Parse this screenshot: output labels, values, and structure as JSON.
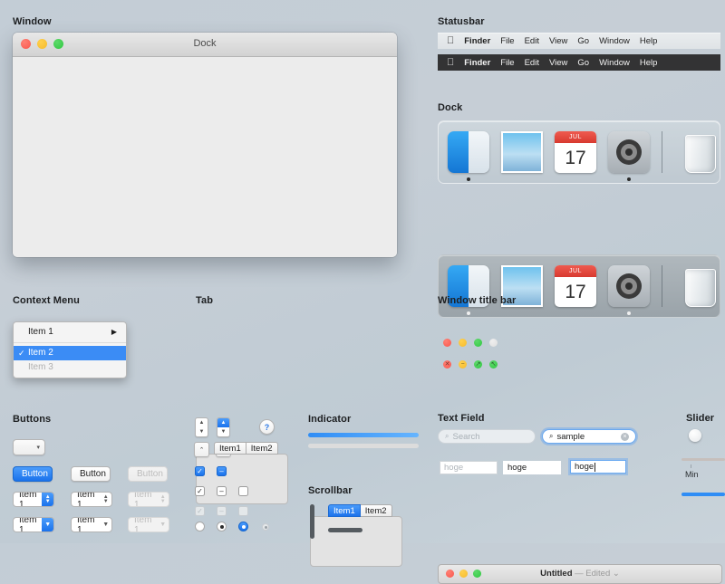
{
  "sections": {
    "window": "Window",
    "statusbar": "Statusbar",
    "dock": "Dock",
    "context_menu": "Context Menu",
    "tab": "Tab",
    "window_title_bar": "Window title bar",
    "buttons": "Buttons",
    "indicator": "Indicator",
    "scrollbar": "Scrollbar",
    "text_field": "Text Field",
    "slider": "Slider"
  },
  "window": {
    "title": "Dock",
    "traffic_lights": [
      "close",
      "minimize",
      "zoom"
    ]
  },
  "menubar": {
    "apple": "",
    "items": [
      {
        "label": "Finder",
        "bold": true
      },
      {
        "label": "File",
        "bold": false
      },
      {
        "label": "Edit",
        "bold": false
      },
      {
        "label": "View",
        "bold": false
      },
      {
        "label": "Go",
        "bold": false
      },
      {
        "label": "Window",
        "bold": false
      },
      {
        "label": "Help",
        "bold": false
      }
    ]
  },
  "dock_items": [
    {
      "name": "Finder",
      "running": true
    },
    {
      "name": "Mail",
      "running": false
    },
    {
      "name": "Calendar",
      "running": false,
      "month": "JUL",
      "day": "17"
    },
    {
      "name": "System Preferences",
      "running": true
    },
    {
      "name": "Trash",
      "running": false
    }
  ],
  "context_menu": {
    "items": [
      {
        "label": "Item 1",
        "state": "normal",
        "submenu": true,
        "check": ""
      },
      {
        "label": "Item 2",
        "state": "selected",
        "submenu": false,
        "check": "✓"
      },
      {
        "label": "Item 3",
        "state": "disabled",
        "submenu": false,
        "check": ""
      }
    ]
  },
  "tabs": {
    "inactive": [
      {
        "label": "Item1",
        "selected": false
      },
      {
        "label": "Item2",
        "selected": false
      }
    ],
    "active": [
      {
        "label": "Item1",
        "selected": true
      },
      {
        "label": "Item2",
        "selected": false
      }
    ]
  },
  "title_bar": {
    "title": "Untitled",
    "separator": "—",
    "edited": "Edited",
    "chevron": "⌄"
  },
  "buttons": {
    "small_dropdown_caret": "▾",
    "rows": [
      {
        "label": "Button",
        "variants": [
          "blue",
          "norm",
          "dis"
        ]
      },
      {
        "label": "Item 1",
        "variants": [
          "blue",
          "norm",
          "dis"
        ],
        "kind": "stepper"
      },
      {
        "label": "Item 1",
        "variants": [
          "blue",
          "norm",
          "dis"
        ],
        "kind": "popup"
      }
    ],
    "help_label": "?",
    "up_arrow": "⌃",
    "down_arrow": "⌄",
    "triangle_down": "▼",
    "triangle_right": "▶",
    "check_glyph": "✓",
    "mixed_glyph": "–"
  },
  "indicator": {
    "progress_percent": 100,
    "empty_percent": 0
  },
  "text_field": {
    "search_placeholder": "Search",
    "search_value": "sample",
    "search_icon": "⌕",
    "clear_icon": "×",
    "field_placeholder": "hoge",
    "field_value": "hoge",
    "field_focus_value": "hoge"
  },
  "slider": {
    "min_label": "Min",
    "value_percent": 100
  },
  "colors": {
    "accent_blue": "#1a72ec",
    "selection_blue": "#3b8cf5",
    "light_red": "#f9564c",
    "light_yellow": "#f5bb2e",
    "light_green": "#30c840",
    "disabled_gray": "#dcdcdc"
  }
}
